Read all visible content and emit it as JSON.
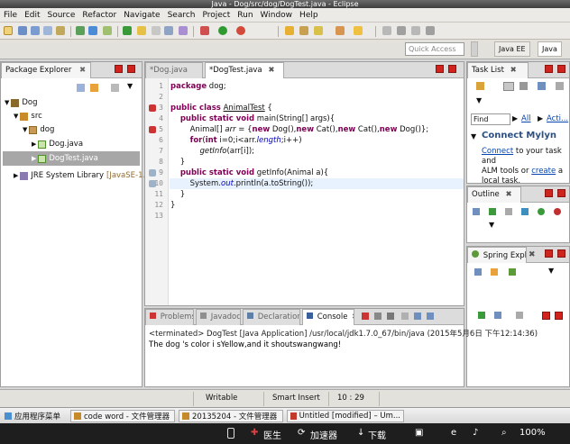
{
  "window": {
    "title": "Java - Dog/src/dog/DogTest.java - Eclipse"
  },
  "menu": [
    "File",
    "Edit",
    "Source",
    "Refactor",
    "Navigate",
    "Search",
    "Project",
    "Run",
    "Window",
    "Help"
  ],
  "quick_access": {
    "placeholder": "Quick Access"
  },
  "perspectives": [
    "Java EE",
    "Java"
  ],
  "package_explorer": {
    "title": "Package Explorer",
    "tree": [
      {
        "label": "Dog",
        "level": 0
      },
      {
        "label": "src",
        "level": 1
      },
      {
        "label": "dog",
        "level": 2
      },
      {
        "label": "Dog.java",
        "level": 3
      },
      {
        "label": "DogTest.java",
        "level": 3,
        "selected": true
      },
      {
        "label": "JRE System Library",
        "extra": "[JavaSE-1.7]",
        "level": 1
      }
    ]
  },
  "editor": {
    "tabs": [
      {
        "label": "*Dog.java",
        "active": false
      },
      {
        "label": "*DogTest.java",
        "active": true
      }
    ],
    "line_numbers": [
      "1",
      "2",
      "3",
      "4",
      "5",
      "6",
      "7",
      "8",
      "9",
      "10",
      "11",
      "12",
      "13"
    ]
  },
  "task_list": {
    "title": "Task List",
    "find_placeholder": "Find",
    "all": "All",
    "acti": "Acti..."
  },
  "mylyn": {
    "title": "Connect Mylyn",
    "connect_link": "Connect",
    "text1": "to your task and",
    "text2": "ALM tools or",
    "create_link": "create",
    "text3": "a",
    "text4": "local task."
  },
  "outline": {
    "title": "Outline"
  },
  "spring": {
    "title": "Spring Expl"
  },
  "bottom": {
    "tabs": [
      "Problems",
      "Javadoc",
      "Declaration",
      "Console"
    ],
    "active_tab": "Console",
    "terminated": "<terminated> DogTest [Java Application] /usr/local/jdk1.7.0_67/bin/java (2015年5月6日 下午12:14:36)",
    "output": "The dog 's color i sYellow,and it shoutswangwang!"
  },
  "status": {
    "writable": "Writable",
    "insert": "Smart Insert",
    "position": "10 : 29"
  },
  "taskbar": [
    "应用程序菜单",
    "code word - 文件管理器",
    "20135204 - 文件管理器",
    "Untitled [modified] – Um..."
  ],
  "tray": {
    "items": [
      "医生",
      "加速器",
      "下载"
    ],
    "zoom": "100%"
  }
}
